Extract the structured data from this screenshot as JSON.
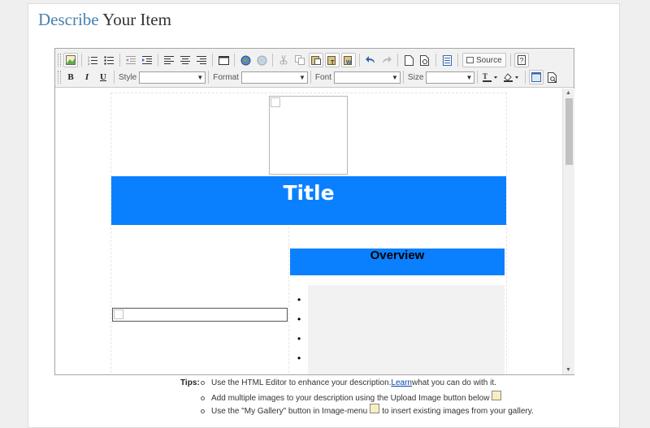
{
  "page": {
    "heading_word1": "Describe",
    "heading_word2": "Your Item"
  },
  "toolbar": {
    "row1": {
      "groups": [
        [
          "insert-image-icon"
        ],
        [
          "numbered-list-icon",
          "bulleted-list-icon"
        ],
        [
          "outdent-icon",
          "indent-icon"
        ],
        [
          "align-left-icon",
          "align-center-icon",
          "align-right-icon"
        ],
        [
          "table-icon"
        ],
        [
          "link-icon",
          "unlink-icon"
        ],
        [
          "cut-icon",
          "copy-icon",
          "paste-icon",
          "paste-text-icon",
          "paste-word-icon"
        ],
        [
          "undo-icon",
          "redo-icon"
        ],
        [
          "new-page-icon",
          "preview-icon"
        ],
        [
          "templates-icon"
        ]
      ],
      "source_label": "Source",
      "help_icon": "help-icon"
    },
    "row2": {
      "bold": "B",
      "italic": "I",
      "underline": "U",
      "style_label": "Style",
      "format_label": "Format",
      "font_label": "Font",
      "size_label": "Size",
      "style_value": "",
      "format_value": "",
      "font_value": "",
      "size_value": "",
      "text_color_icon": "text-color-icon",
      "bg_color_icon": "background-color-icon",
      "maximize_icon": "maximize-icon",
      "show_blocks_icon": "show-blocks-icon"
    }
  },
  "content": {
    "title": "Title",
    "overview": "Overview",
    "bullet_char": "•",
    "bullet_count": 4
  },
  "tips": {
    "label": "Tips:",
    "items": [
      {
        "before": "Use the HTML Editor to enhance your description. ",
        "link": "Learn",
        "after": " what you can do with it."
      },
      {
        "before": "Add multiple images to your description using the Upload Image button below",
        "link": "",
        "after": ""
      },
      {
        "before": "Use the \"My Gallery\" button in Image-menu",
        "link": "",
        "after": " to insert existing images from your gallery."
      }
    ]
  },
  "colors": {
    "heading_accent": "#4a7fb0",
    "title_bar": "#0a80ff",
    "link": "#0645ad"
  }
}
